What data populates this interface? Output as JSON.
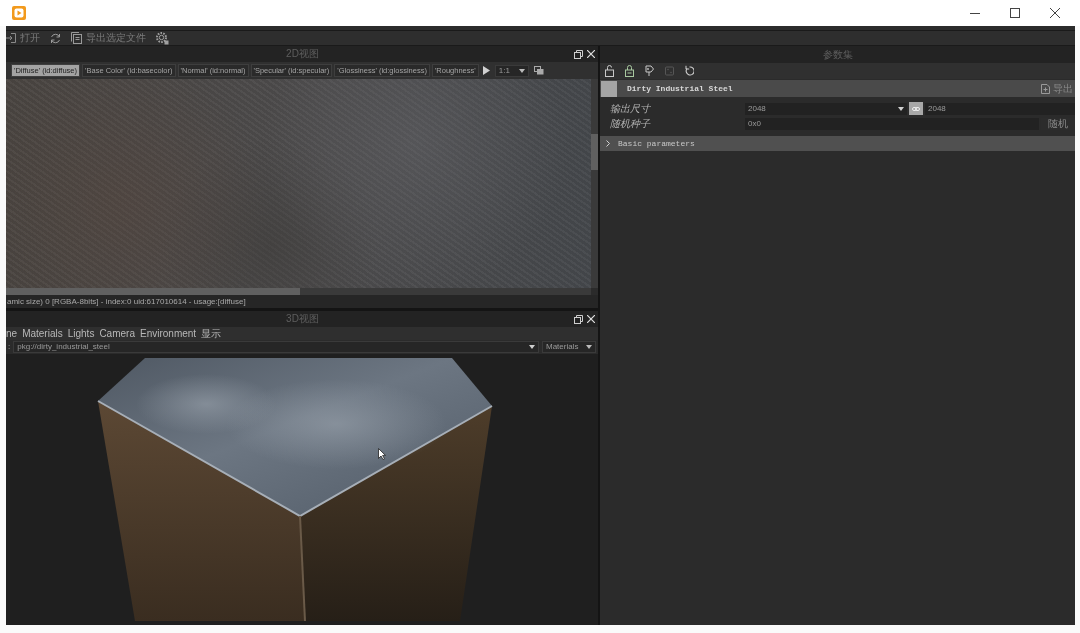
{
  "toolbar": [
    {
      "kind": "open",
      "label": "打开"
    },
    {
      "kind": "refresh"
    },
    {
      "kind": "export",
      "label": "导出选定文件"
    },
    {
      "kind": "settings"
    }
  ],
  "viewer_2d": {
    "title": "2D视图",
    "tabs": [
      {
        "label": "'Diffuse' (id:diffuse)",
        "selected": true
      },
      {
        "label": "'Base Color' (id:basecolor)",
        "selected": false
      },
      {
        "label": "'Normal' (id:normal)",
        "selected": false
      },
      {
        "label": "'Specular' (id:specular)",
        "selected": false
      },
      {
        "label": "'Glossiness' (id:glossiness)",
        "selected": false
      },
      {
        "label": "'Roughness'",
        "selected": false
      }
    ],
    "zoom": "1:1",
    "status": "amic size) 0 [RGBA-8bits] - index:0 uid:617010614 - usage:[diffuse]"
  },
  "viewer_3d": {
    "title": "3D视图",
    "menu": [
      "ne",
      "Materials",
      "Lights",
      "Camera",
      "Environment",
      "显示"
    ],
    "material": {
      "label": ":",
      "value": "pkg://dirty_industrial_steel"
    },
    "material_menu": "Materials"
  },
  "parameters": {
    "title": "参数集",
    "tools": [
      {
        "kind": "unlock",
        "disabled": false
      },
      {
        "kind": "lock",
        "disabled": false
      },
      {
        "kind": "tag",
        "disabled": false
      },
      {
        "kind": "dice",
        "disabled": true
      },
      {
        "kind": "reset",
        "disabled": false
      }
    ],
    "graph": {
      "name": "Dirty Industrial Steel",
      "action": "导出"
    },
    "rows": [
      {
        "kind": "size",
        "label": "输出尺寸",
        "value": "2048",
        "linked": true,
        "value_2": "2048"
      },
      {
        "kind": "seed",
        "label": "随机种子",
        "value": "0x0",
        "button": "随机"
      }
    ],
    "sections": [
      {
        "label": "Basic parameters",
        "expanded": false
      }
    ]
  }
}
